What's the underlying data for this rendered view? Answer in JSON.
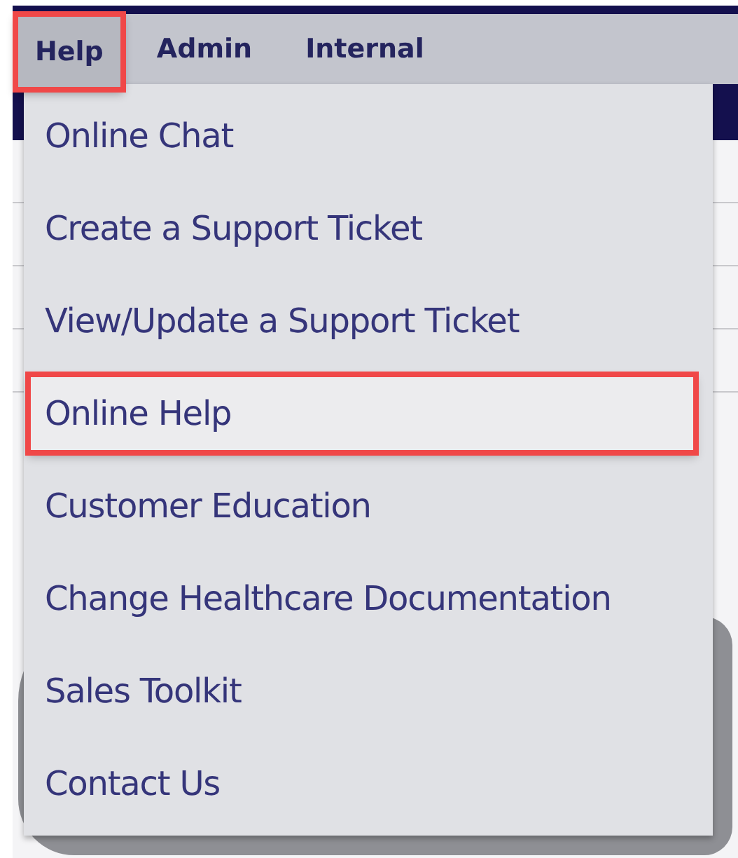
{
  "menu_bar": {
    "items": [
      {
        "label": "Help",
        "selected": true
      },
      {
        "label": "Admin",
        "selected": false
      },
      {
        "label": "Internal",
        "selected": false
      }
    ]
  },
  "help_menu": {
    "items": [
      {
        "label": "Online Chat",
        "selected": false
      },
      {
        "label": "Create a Support Ticket",
        "selected": false
      },
      {
        "label": "View/Update a Support Ticket",
        "selected": false
      },
      {
        "label": "Online Help",
        "selected": true
      },
      {
        "label": "Customer Education",
        "selected": false
      },
      {
        "label": "Change Healthcare Documentation",
        "selected": false
      },
      {
        "label": "Sales Toolkit",
        "selected": false
      },
      {
        "label": "Contact Us",
        "selected": false
      }
    ]
  }
}
